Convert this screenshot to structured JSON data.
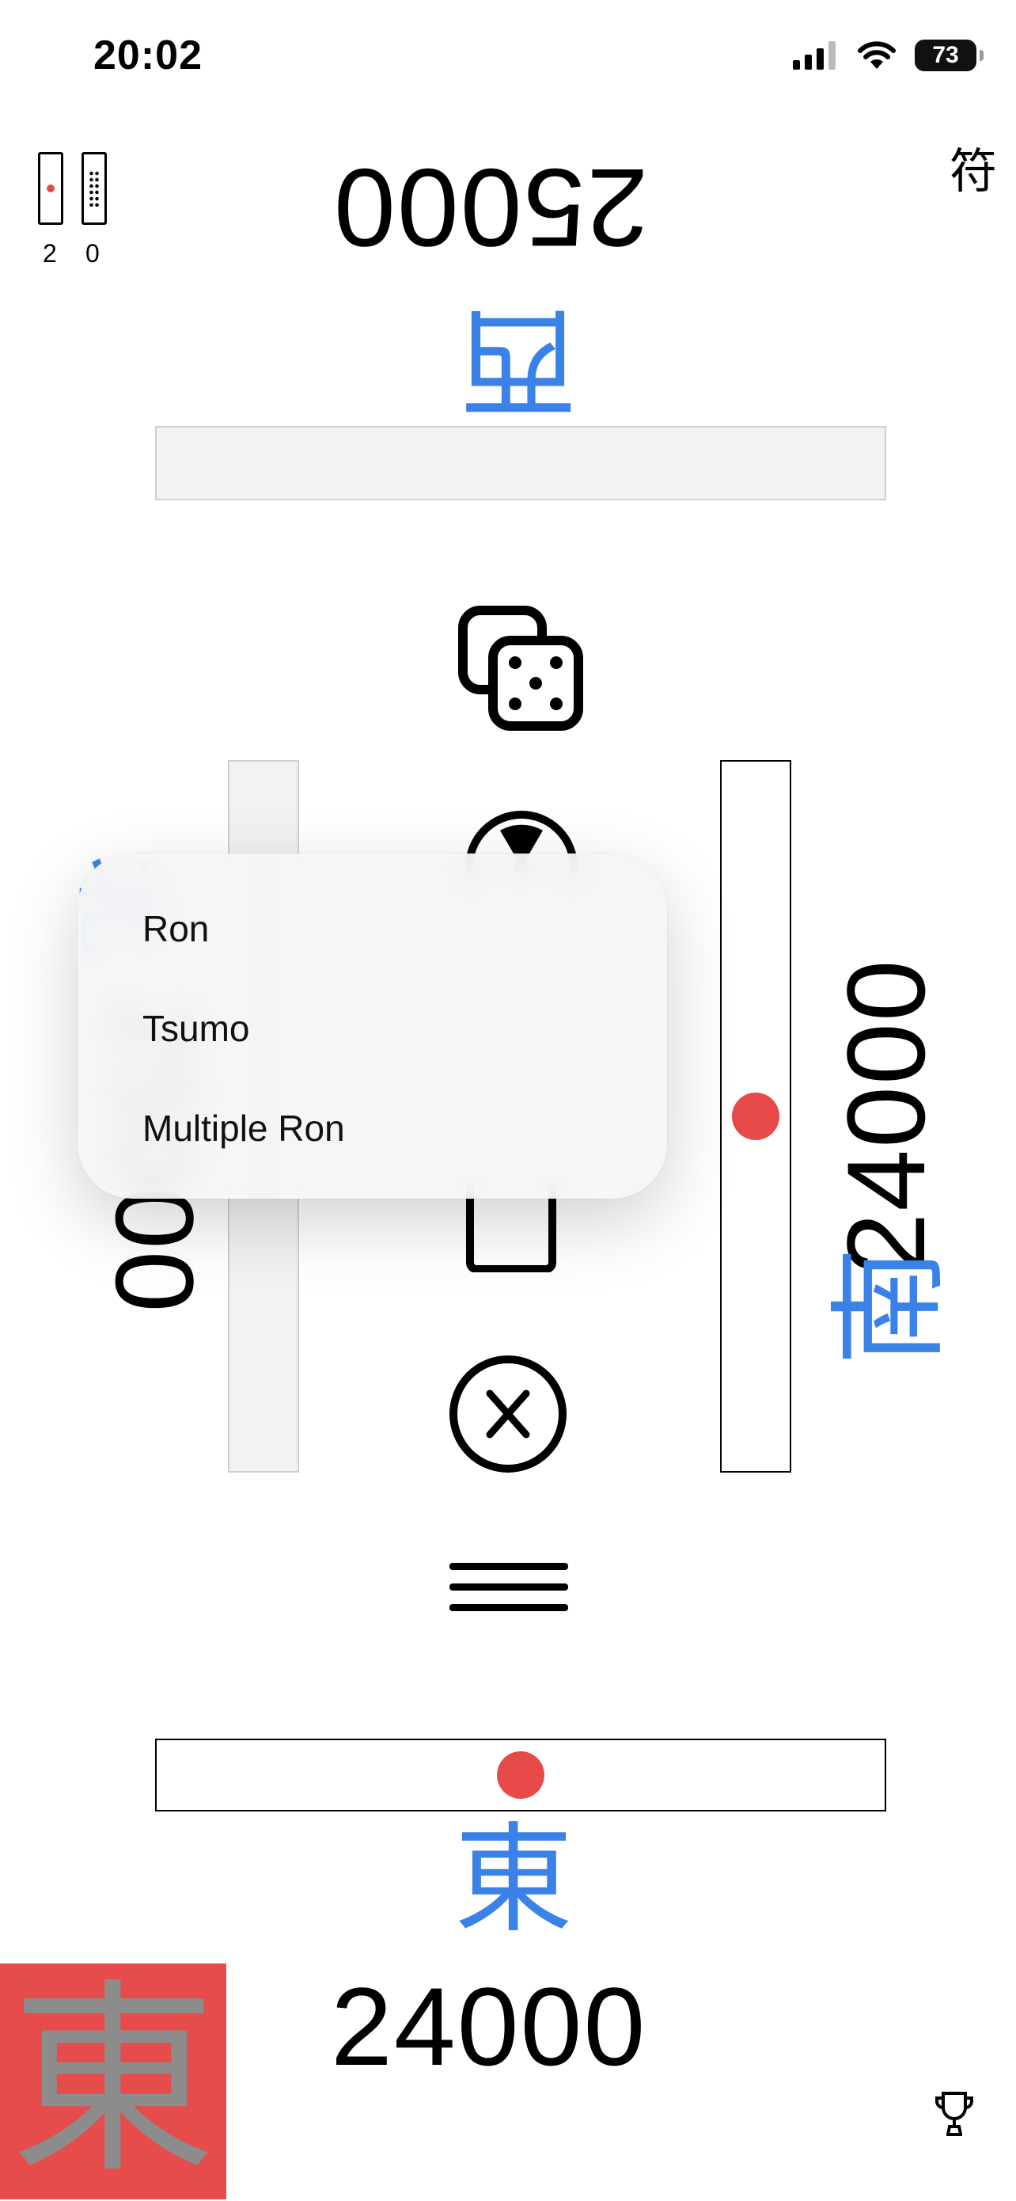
{
  "status_bar": {
    "time": "20:02",
    "battery": "73"
  },
  "sticks": {
    "riichi_count": "2",
    "honba_count": "0"
  },
  "fu_label": "符",
  "players": {
    "top": {
      "score": "25000",
      "wind": "西"
    },
    "right": {
      "score": "24000",
      "wind": "南"
    },
    "left": {
      "score": "25000",
      "wind": "北"
    },
    "bottom": {
      "score": "24000",
      "wind": "東"
    }
  },
  "dealer_badge": "東",
  "popup_menu": {
    "items": [
      "Ron",
      "Tsumo",
      "Multiple Ron"
    ]
  },
  "colors": {
    "accent_blue": "#3b82e8",
    "riichi_red": "#e84a4a",
    "badge_red": "#e74c4c"
  }
}
